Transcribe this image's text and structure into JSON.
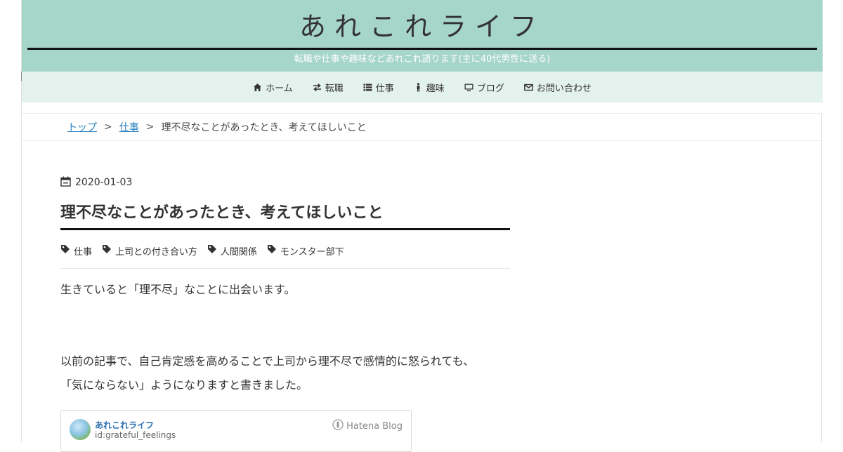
{
  "site": {
    "title": "あれこれライフ",
    "tagline": "転職や仕事や趣味などあれこれ語ります(主に40代男性に送る)"
  },
  "nav": {
    "items": [
      {
        "label": "ホーム",
        "icon": "home-icon"
      },
      {
        "label": "転職",
        "icon": "exchange-icon"
      },
      {
        "label": "仕事",
        "icon": "list-icon"
      },
      {
        "label": "趣味",
        "icon": "person-icon"
      },
      {
        "label": "ブログ",
        "icon": "monitor-icon"
      },
      {
        "label": "お問い合わせ",
        "icon": "envelope-icon"
      }
    ]
  },
  "breadcrumb": {
    "items": [
      "トップ",
      "仕事"
    ],
    "separator": ">",
    "current": "理不尽なことがあったとき、考えてほしいこと"
  },
  "article": {
    "date": "2020-01-03",
    "title": "理不尽なことがあったとき、考えてほしいこと",
    "tags": [
      "仕事",
      "上司との付き合い方",
      "人間関係",
      "モンスター部下"
    ],
    "paragraph1": "生きていると「理不尽」なことに出会います。",
    "paragraph2_line1": "以前の記事で、自己肯定感を高めることで上司から理不尽で感情的に怒られても、",
    "paragraph2_line2": "「気にならない」ようになりますと書きました。"
  },
  "embed": {
    "name": "あれこれライフ",
    "id": "id:grateful_feelings",
    "brand": "Hatena Blog"
  },
  "colors": {
    "header_bg": "#a6d5ca",
    "nav_bg": "#e4f2ee",
    "link": "#2a7fbf"
  }
}
